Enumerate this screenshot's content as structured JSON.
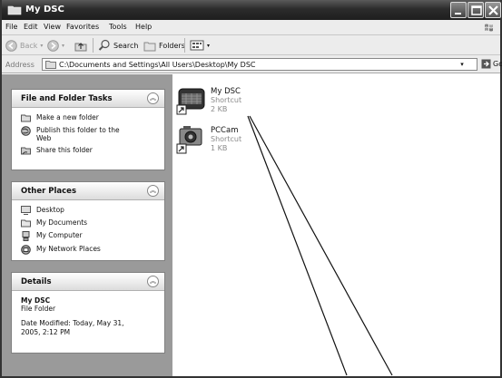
{
  "window": {
    "title": "My DSC",
    "controls": [
      "minimize",
      "maximize",
      "close"
    ]
  },
  "menubar": {
    "items": [
      {
        "label": "File"
      },
      {
        "label": "Edit"
      },
      {
        "label": "View"
      },
      {
        "label": "Favorites"
      },
      {
        "label": "Tools"
      },
      {
        "label": "Help"
      }
    ]
  },
  "toolbar": {
    "back_label": "Back",
    "search_label": "Search",
    "folders_label": "Folders"
  },
  "address": {
    "label": "Address",
    "path": "C:\\Documents and Settings\\All Users\\Desktop\\My DSC",
    "go_label": "Go"
  },
  "taskpane": {
    "file_tasks": {
      "title": "File and Folder Tasks",
      "items": [
        {
          "label": "Make a new folder",
          "icon": "new-folder-icon"
        },
        {
          "label": "Publish this folder to the Web",
          "icon": "globe-icon"
        },
        {
          "label": "Share this folder",
          "icon": "share-folder-icon"
        }
      ]
    },
    "other_places": {
      "title": "Other Places",
      "items": [
        {
          "label": "Desktop",
          "icon": "desktop-icon"
        },
        {
          "label": "My Documents",
          "icon": "documents-folder-icon"
        },
        {
          "label": "My Computer",
          "icon": "computer-icon"
        },
        {
          "label": "My Network Places",
          "icon": "network-icon"
        }
      ]
    },
    "details": {
      "title": "Details",
      "name": "My DSC",
      "type": "File Folder",
      "modified": "Date Modified: Today, May 31, 2005, 2:12 PM"
    }
  },
  "files": [
    {
      "name": "My DSC",
      "type": "Shortcut",
      "size": "2 KB",
      "icon": "camera-shortcut-icon"
    },
    {
      "name": "PCCam",
      "type": "Shortcut",
      "size": "1 KB",
      "icon": "webcam-shortcut-icon"
    }
  ]
}
